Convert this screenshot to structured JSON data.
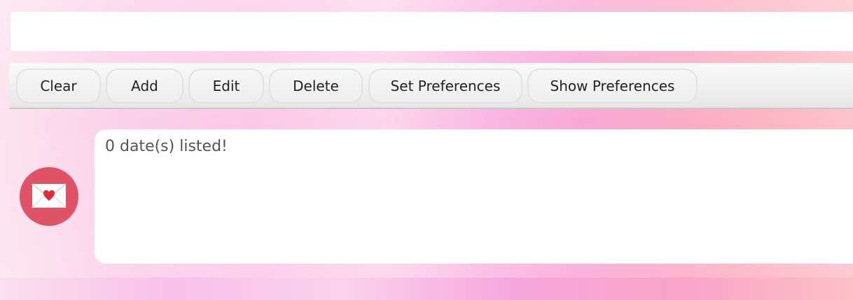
{
  "command": {
    "value": "",
    "placeholder": ""
  },
  "toolbar": {
    "buttons": [
      {
        "label": "Clear"
      },
      {
        "label": "Add"
      },
      {
        "label": "Edit"
      },
      {
        "label": "Delete"
      },
      {
        "label": "Set Preferences"
      },
      {
        "label": "Show Preferences"
      }
    ]
  },
  "result": {
    "text": "0 date(s) listed!"
  },
  "avatar": {
    "icon": "love-letter-icon",
    "color": "#e05266"
  }
}
